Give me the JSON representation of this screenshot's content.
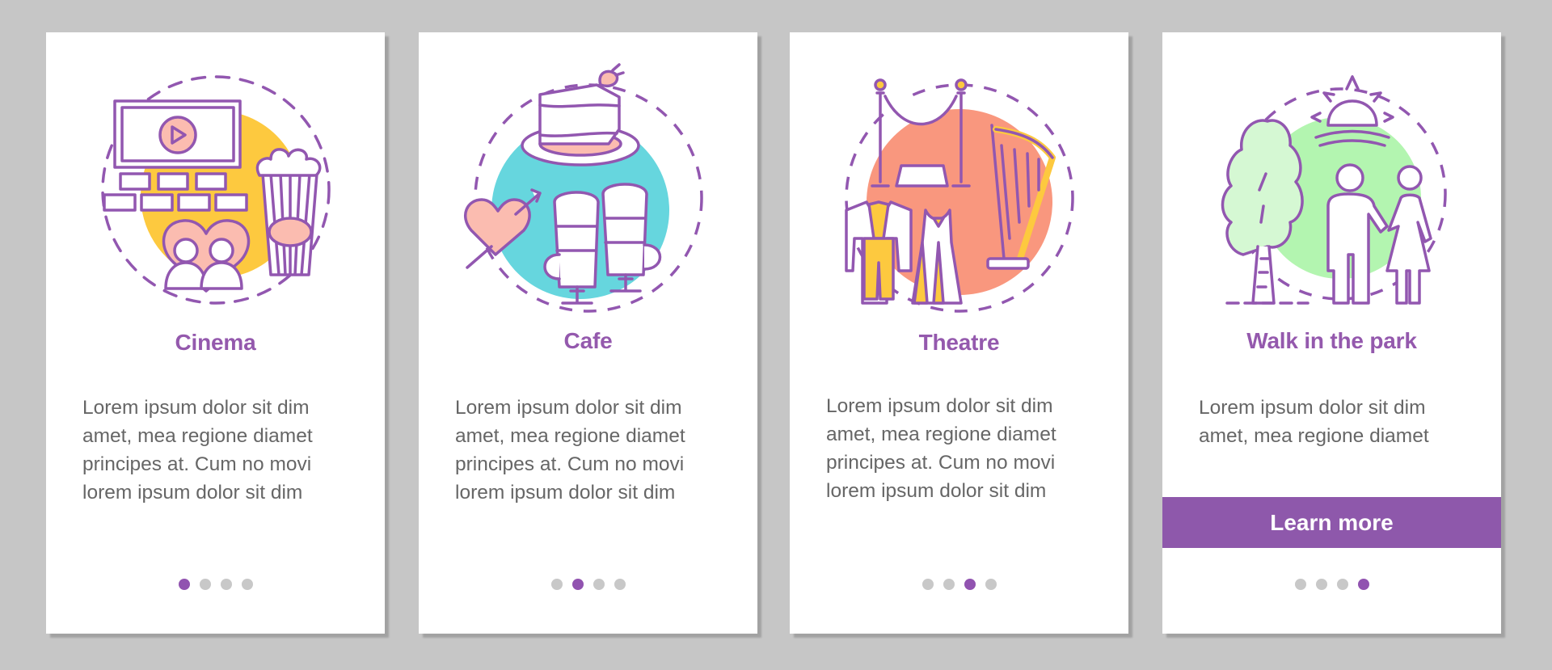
{
  "colors": {
    "background": "#c6c6c6",
    "accent": "#9459ad",
    "stroke": "#9257b0",
    "dot_inactive": "#c8c8c8",
    "dot_active": "#9153b0",
    "button": "#8e58ab",
    "body_text": "#666666"
  },
  "cards": [
    {
      "title": "Cinema",
      "icon": "cinema-illustration",
      "accent_fill": "#fdc93f",
      "body": "Lorem ipsum dolor sit dim\namet, mea regione diamet\nprincipes at. Cum no movi\nlorem ipsum dolor sit dim",
      "page": 1,
      "total_pages": 4
    },
    {
      "title": "Cafe",
      "icon": "cafe-illustration",
      "accent_fill": "#66d6de",
      "body": "Lorem ipsum dolor sit dim\namet, mea regione diamet\nprincipes at. Cum no movi\nlorem ipsum dolor sit dim",
      "page": 2,
      "total_pages": 4
    },
    {
      "title": "Theatre",
      "icon": "theatre-illustration",
      "accent_fill": "#f9977e",
      "body": "Lorem ipsum dolor sit dim\namet, mea regione diamet\nprincipes at. Cum no movi\nlorem ipsum dolor sit dim",
      "page": 3,
      "total_pages": 4
    },
    {
      "title": "Walk in the park",
      "icon": "park-walk-illustration",
      "accent_fill": "#b3f5b0",
      "body": "Lorem ipsum dolor sit dim\namet, mea regione diamet",
      "page": 4,
      "total_pages": 4,
      "button_label": "Learn more"
    }
  ]
}
